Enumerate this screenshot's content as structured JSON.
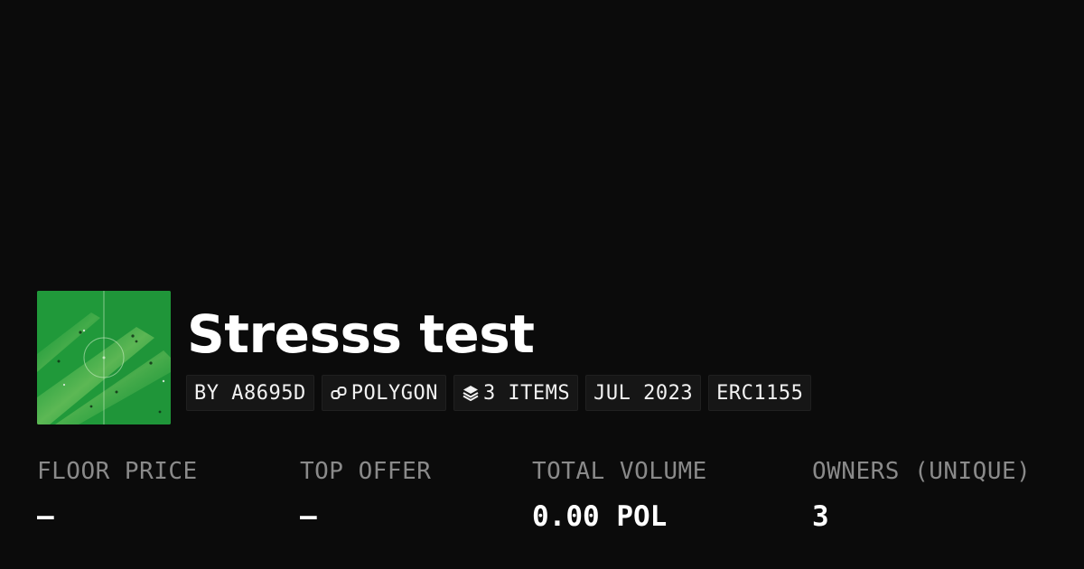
{
  "collection": {
    "title": "Stresss test",
    "thumbnail_icon": "soccer-field-thumbnail"
  },
  "tags": {
    "creator": "BY A8695D",
    "chain": "POLYGON",
    "chain_icon": "link-icon",
    "items": "3 ITEMS",
    "items_icon": "layers-icon",
    "date": "JUL 2023",
    "standard": "ERC1155"
  },
  "stats": {
    "floor_price": {
      "label": "FLOOR PRICE",
      "value": "–"
    },
    "top_offer": {
      "label": "TOP OFFER",
      "value": "–"
    },
    "total_volume": {
      "label": "TOTAL VOLUME",
      "value": "0.00 POL"
    },
    "owners": {
      "label": "OWNERS (UNIQUE)",
      "value": "3"
    }
  },
  "colors": {
    "background": "#0b0b0b",
    "tag_background": "#161616",
    "label_gray": "#8a8a8a",
    "text": "#ffffff",
    "thumbnail_green": "#25a23f"
  }
}
